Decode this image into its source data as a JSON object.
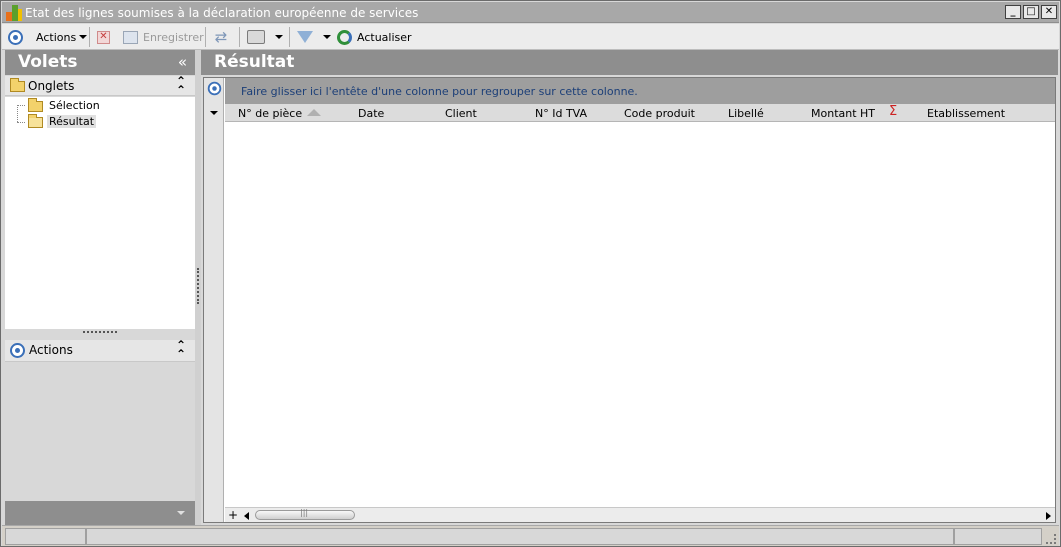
{
  "window": {
    "title": "Etat des lignes soumises à la déclaration européenne de services",
    "buttons": {
      "minimize": "_",
      "maximize": "□",
      "close": "✕"
    }
  },
  "toolbar": {
    "actions_label": "Actions",
    "save_label": "Enregistrer",
    "refresh_label": "Actualiser"
  },
  "left_panel": {
    "title": "Volets",
    "collapse_glyph": "«",
    "onglets": {
      "label": "Onglets",
      "items": [
        {
          "label": "Sélection",
          "selected": false
        },
        {
          "label": "Résultat",
          "selected": true
        }
      ]
    },
    "actions_section": {
      "label": "Actions"
    }
  },
  "result_panel": {
    "title": "Résultat",
    "group_hint": "Faire glisser ici l'entête d'une colonne pour regrouper sur cette colonne.",
    "columns": [
      "N° de pièce",
      "Date",
      "Client",
      "N° Id TVA",
      "Code produit",
      "Libellé",
      "Montant HT",
      "Etablissement"
    ],
    "sigma": "Σ",
    "rows": []
  },
  "scroll": {
    "plus": "+"
  },
  "colors": {
    "header_gray": "#8e8e8e",
    "group_text": "#1c3f78",
    "accent_blue": "#3a6fb8",
    "sigma_red": "#cc2222"
  }
}
